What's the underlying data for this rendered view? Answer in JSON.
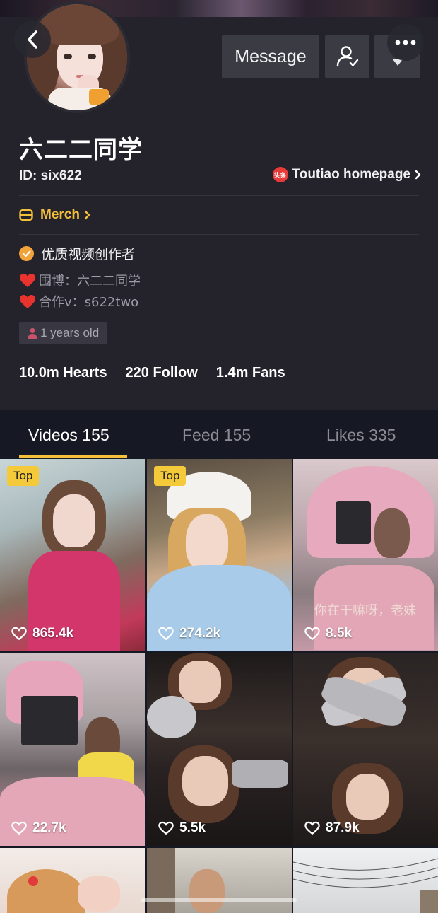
{
  "profile": {
    "name": "六二二同学",
    "id_label": "ID: six622",
    "toutiao_label": "Toutiao homepage",
    "toutiao_badge": "头条",
    "merch_label": "Merch",
    "verified_text": "优质视频创作者",
    "bio_line1": "围博：六二二同学",
    "bio_line2": "合作v：s622two",
    "age_label": "1 years old"
  },
  "actions": {
    "message_label": "Message"
  },
  "stats": {
    "hearts": "10.0m Hearts",
    "follow": "220 Follow",
    "fans": "1.4m Fans"
  },
  "tabs": [
    {
      "label": "Videos 155"
    },
    {
      "label": "Feed 155"
    },
    {
      "label": "Likes 335"
    }
  ],
  "videos": [
    {
      "likes": "865.4k",
      "badge": "Top"
    },
    {
      "likes": "274.2k",
      "badge": "Top"
    },
    {
      "likes": "8.5k",
      "caption": "你在干嘛呀，老妹"
    },
    {
      "likes": "22.7k"
    },
    {
      "likes": "5.5k"
    },
    {
      "likes": "87.9k"
    }
  ],
  "colors": {
    "background": "#161823",
    "header": "#24232c",
    "accent_yellow": "#f4c03a",
    "button": "#3b3b44",
    "muted_text": "#9d9ca6"
  }
}
